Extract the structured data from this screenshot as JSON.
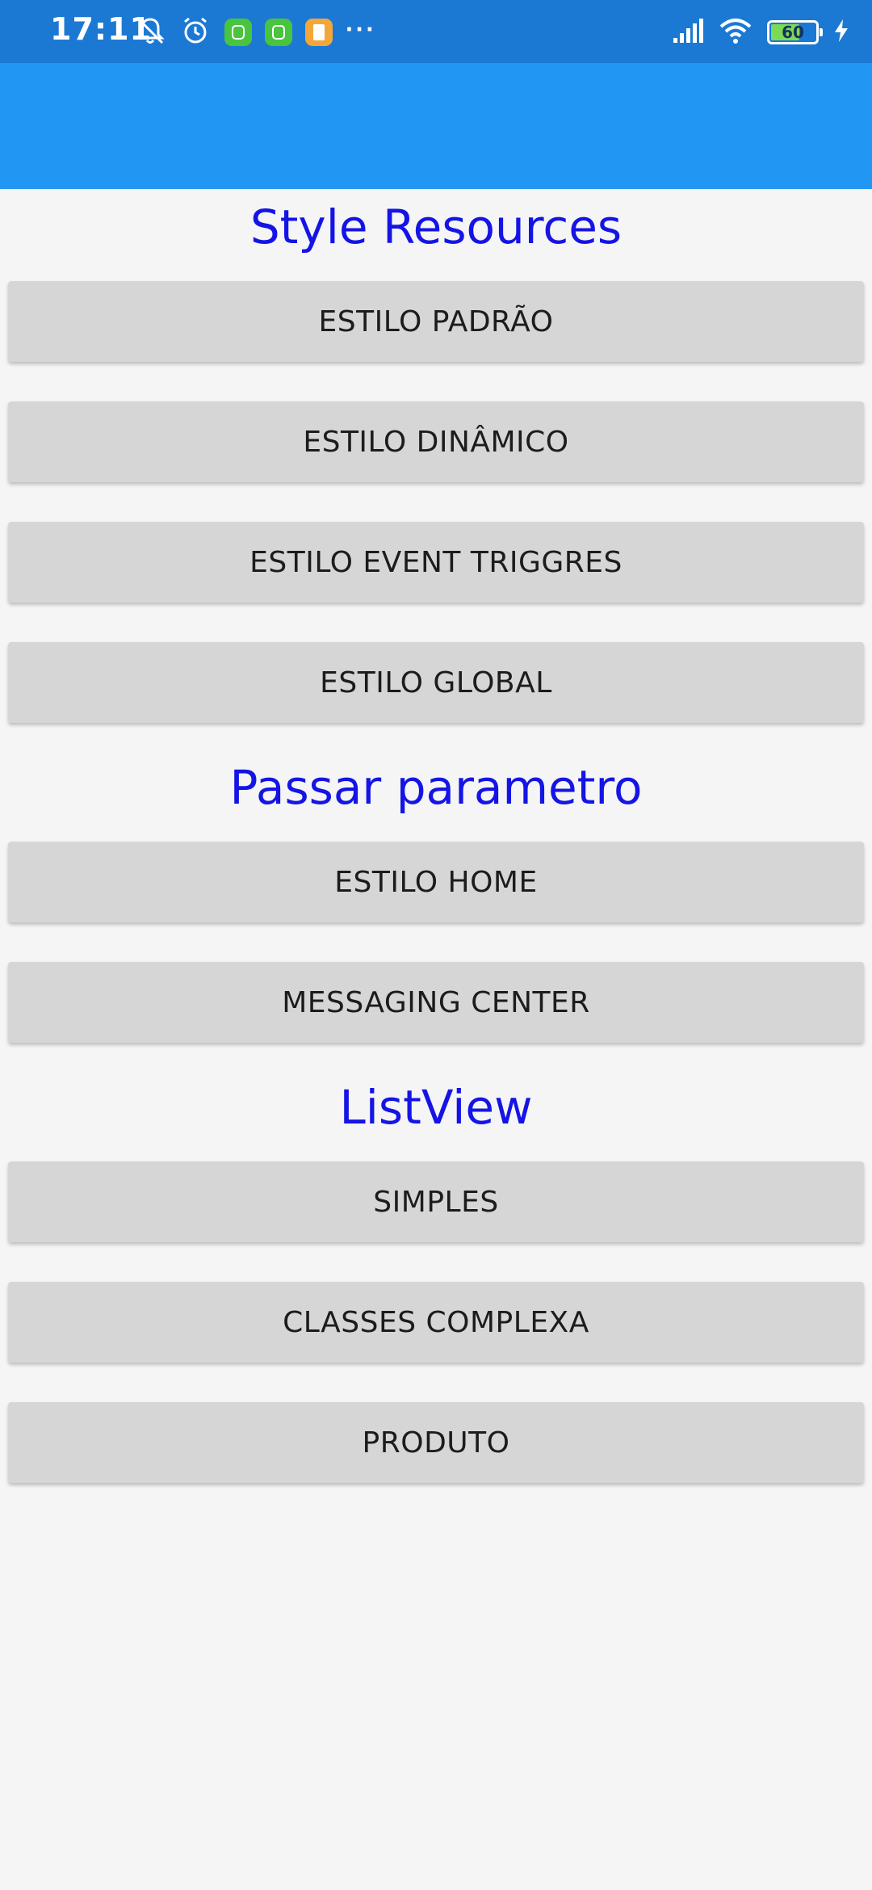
{
  "status_bar": {
    "time": "17:11",
    "battery_level": "60",
    "icons_left": [
      "mute-alarm-icon",
      "alarm-clock-icon",
      "android-app-icon",
      "android-app-icon",
      "notes-app-icon",
      "more-icon"
    ],
    "icons_right": [
      "signal-icon",
      "wifi-icon",
      "battery-icon",
      "charging-bolt-icon"
    ],
    "more_label": "···"
  },
  "colors": {
    "status_bar": "#1b79d3",
    "toolbar": "#2196f3",
    "section_title": "#1414e6",
    "button_bg": "#d6d6d6",
    "page_bg": "#f5f5f5"
  },
  "sections": [
    {
      "title": "Style Resources",
      "buttons": [
        "ESTILO PADRÃO",
        "ESTILO DINÂMICO",
        "ESTILO EVENT TRIGGRES",
        "ESTILO GLOBAL"
      ]
    },
    {
      "title": "Passar parametro",
      "buttons": [
        "ESTILO HOME",
        "MESSAGING CENTER"
      ]
    },
    {
      "title": "ListView",
      "buttons": [
        "SIMPLES",
        "CLASSES COMPLEXA",
        "PRODUTO"
      ]
    }
  ]
}
